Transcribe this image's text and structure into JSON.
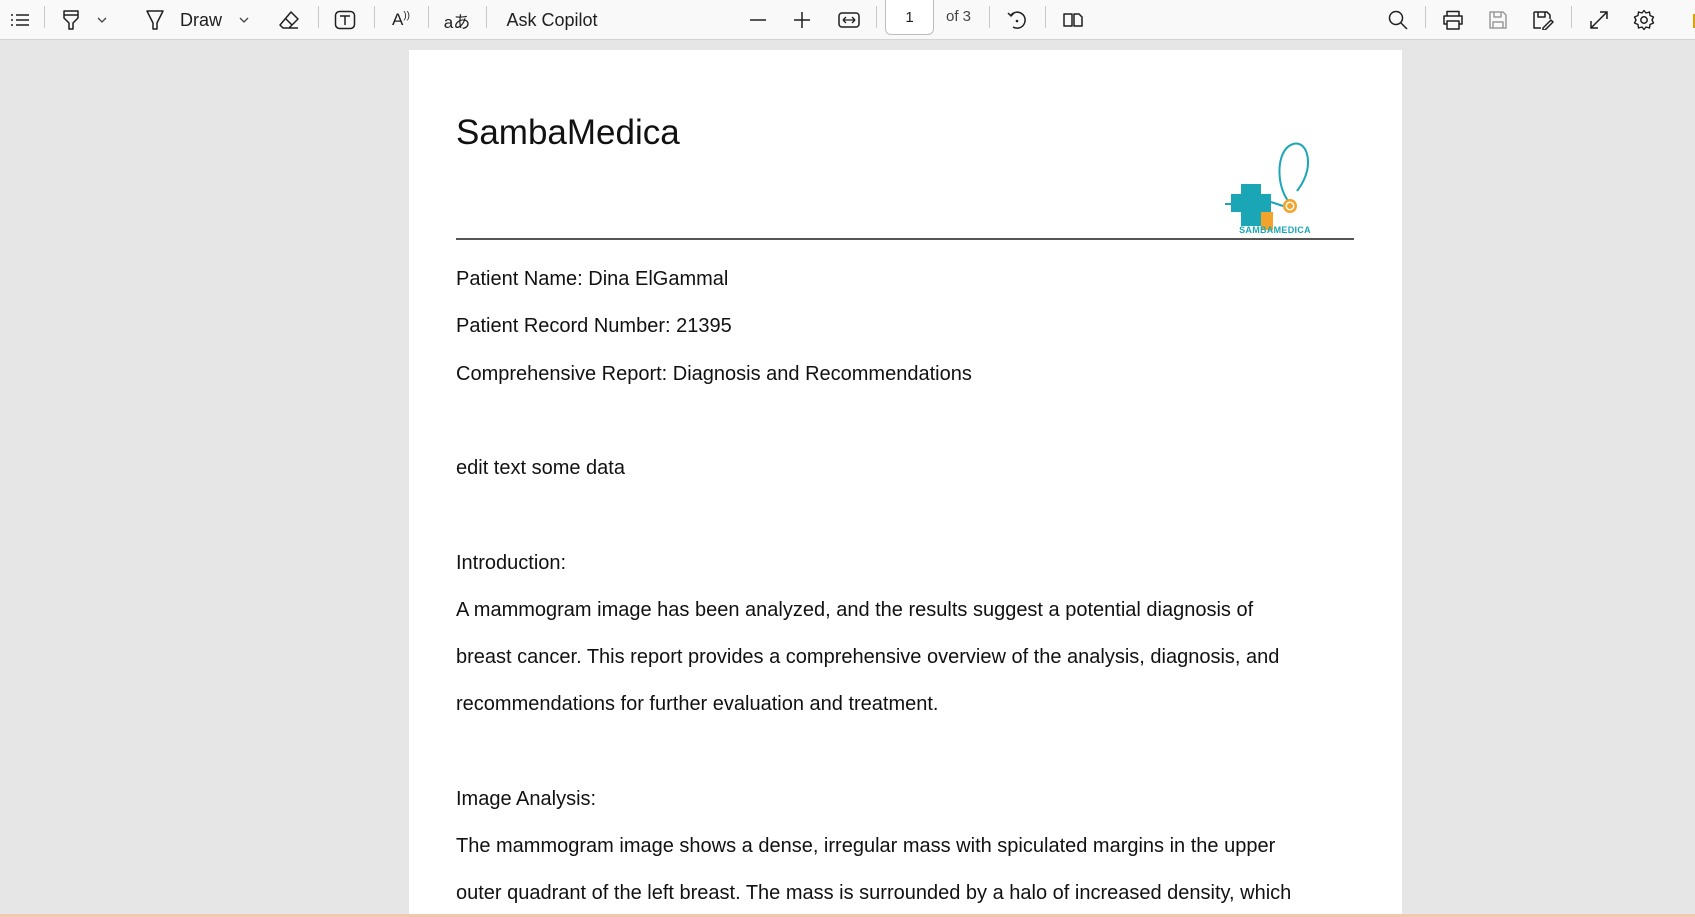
{
  "toolbar": {
    "draw_label": "Draw",
    "ask_copilot_label": "Ask Copilot",
    "current_page": "1",
    "of_pages": "of 3"
  },
  "document": {
    "title": "SambaMedica",
    "logo_text": "SAMBAMEDICA",
    "patient_name": "Patient Name: Dina ElGammal",
    "record_number": "Patient Record Number: 21395",
    "report_title": "Comprehensive Report: Diagnosis and Recommendations",
    "edit_text": "edit text some data",
    "introduction_heading": "Introduction:",
    "introduction_lines": [
      "A mammogram image has been analyzed, and the results suggest a potential diagnosis of",
      "breast cancer. This report provides a comprehensive overview of the analysis, diagnosis, and",
      "recommendations for further evaluation and treatment."
    ],
    "image_analysis_heading": "Image Analysis:",
    "image_analysis_lines": [
      "The mammogram image shows a dense, irregular mass with spiculated margins in the upper",
      "outer quadrant of the left breast. The mass is surrounded by a halo of increased density, which"
    ]
  },
  "colors": {
    "logo_teal": "#1aa6b5",
    "logo_orange": "#f3a32a"
  }
}
